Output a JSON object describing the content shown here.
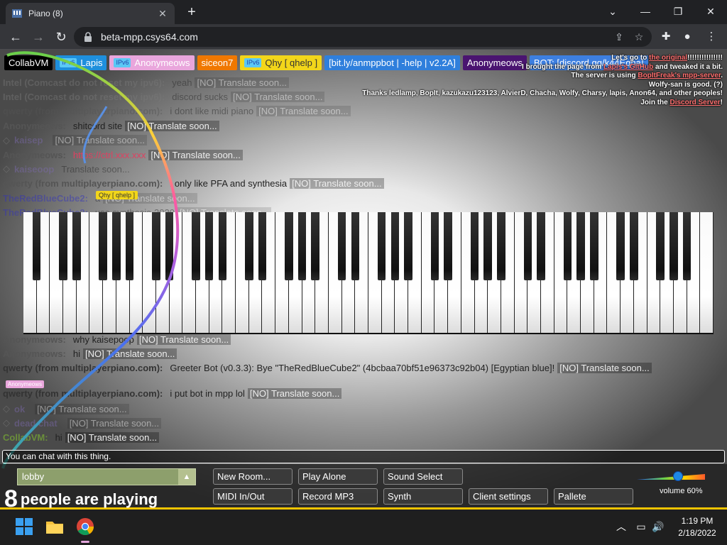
{
  "browser": {
    "tab_title": "Piano (8)",
    "tab_close": "✕",
    "new_tab": "+",
    "url": "beta-mpp.csys64.com"
  },
  "users": [
    {
      "label": "CollabVM",
      "bg": "#000000",
      "v6": false
    },
    {
      "label": "Lapis",
      "bg": "#1e8fdc",
      "v6": true
    },
    {
      "label": "Anonymeows",
      "bg": "#e9a6dc",
      "v6": true
    },
    {
      "label": "siceon7",
      "bg": "#f07800",
      "v6": false
    },
    {
      "label": "Qhy [ qhelp ]",
      "bg": "#f2d61a",
      "v6": true,
      "fg": "#333333"
    },
    {
      "label": "[bit.ly/anmppbot | -help | v2.2A]",
      "bg": "#2f7fdc",
      "v6": false
    },
    {
      "label": "Anonymeows",
      "bg": "#4a1470",
      "v6": false
    },
    {
      "label": "BOT: [discord.gg/k44Eqha]",
      "bg": "#3d7fe0",
      "v6": false
    }
  ],
  "ipv6_badge": "IPv6",
  "notice": {
    "l1a": "Let's go to ",
    "l1link": "the original",
    "l1b": "!!!!!!!!!!!!!!!",
    "l2a": "I brought the page from ",
    "l2link": "Lapis's GitHub",
    "l2b": " and tweaked it a bit.",
    "l3a": "The server is using ",
    "l3link": "BopItFreak's mpp-server",
    "l3b": ".",
    "l4": "Wolfy-san is good. (?)",
    "l5": "Thanks ledlamp, BopIt, kazukazu123123, AlvierD, Chacha, Wolfy, Charsy, lapis, Anon64, and other peoples!",
    "l6a": "Join the ",
    "l6link": "Discord Server",
    "l6b": "!"
  },
  "translate_tag": "[NO] Translate soon...",
  "chat": [
    {
      "nick": "Intel (Comcast do not reset my ipv6):",
      "color": "#7a7a7a",
      "text": "yeah",
      "dim": true
    },
    {
      "nick": "Intel (Comcast do not reset my ipv6):",
      "color": "#7a7a7a",
      "text": "discord sucks",
      "dim": true
    },
    {
      "nick": "qwerty (from multiplayerpiano.com):",
      "color": "#555555",
      "text": "i dont like midi piano",
      "dim": true
    },
    {
      "nick": "Anonymeows:",
      "color": "#555555",
      "text": "shitcord site",
      "dim": false
    },
    {
      "nick": "kaisep",
      "color": "#7d6bb0",
      "text": "",
      "dim": true,
      "diamond": true
    },
    {
      "nick": "Anonymeows:",
      "color": "#555555",
      "text": "https://ctrl.xxx.xxx",
      "dim": false,
      "textcolor": "#e04060"
    },
    {
      "nick": "kaiseoop",
      "color": "#7d6bb0",
      "text": "Translate soon...",
      "dim": true,
      "diamond": true,
      "notr": true
    },
    {
      "nick": "qwerty (from multiplayerpiano.com):",
      "color": "#555555",
      "text": "i only like PFA and synthesia",
      "dim": false
    },
    {
      "nick": "TheRedBlueCube2:",
      "color": "#3030c0",
      "text": "a",
      "dim": true
    },
    {
      "nick": "TheRedBlueCube2:",
      "color": "#3030c0",
      "text": "use synthesia 2020",
      "dim": true
    }
  ],
  "chat_lower": [
    {
      "nick": "Anonymeows:",
      "color": "#555555",
      "text": "why kaisepoop",
      "dim": false
    },
    {
      "nick": "Anonymeows:",
      "color": "#555555",
      "text": "hi",
      "dim": false
    },
    {
      "nick": "qwerty (from multiplayerpiano.com):",
      "color": "#333333",
      "text": "Greeter Bot (v0.3.3): Bye \"TheRedBlueCube2\" (4bcbaa70bf51e96373c92b04) [Egyptian blue]!",
      "dim": false,
      "textcolor": "#222222"
    },
    {
      "nick": "qwerty (from multiplayerpiano.com):",
      "color": "#333333",
      "text": "i put bot in mpp lol",
      "dim": false
    },
    {
      "nick": "ok",
      "color": "#7d6bb0",
      "text": "",
      "dim": true,
      "diamond": true
    },
    {
      "nick": "dead chat",
      "color": "#7d6bb0",
      "text": "",
      "dim": true,
      "diamond": true
    },
    {
      "nick": "CollabVM:",
      "color": "#6a8f3a",
      "text": "hi",
      "dim": false
    }
  ],
  "piano": {
    "white_keys": 52,
    "black_pattern": [
      1,
      1,
      0,
      1,
      1,
      1,
      0
    ]
  },
  "cursor_label": "Qhy [ qhelp ]",
  "anon_label": "Anonymeows",
  "chat_input_placeholder": "You can chat with this thing.",
  "room": {
    "name": "lobby",
    "arrow": "▲"
  },
  "playing": {
    "count": "8",
    "text": "people are playing"
  },
  "buttons": {
    "new_room": "New Room...",
    "play_alone": "Play Alone",
    "sound_select": "Sound Select",
    "midi": "MIDI In/Out",
    "record": "Record MP3",
    "synth": "Synth",
    "client_settings": "Client settings",
    "pallete": "Pallete"
  },
  "volume": {
    "label": "volume 60%",
    "value": 0.6
  },
  "clock": {
    "time": "1:19 PM",
    "date": "2/18/2022"
  }
}
